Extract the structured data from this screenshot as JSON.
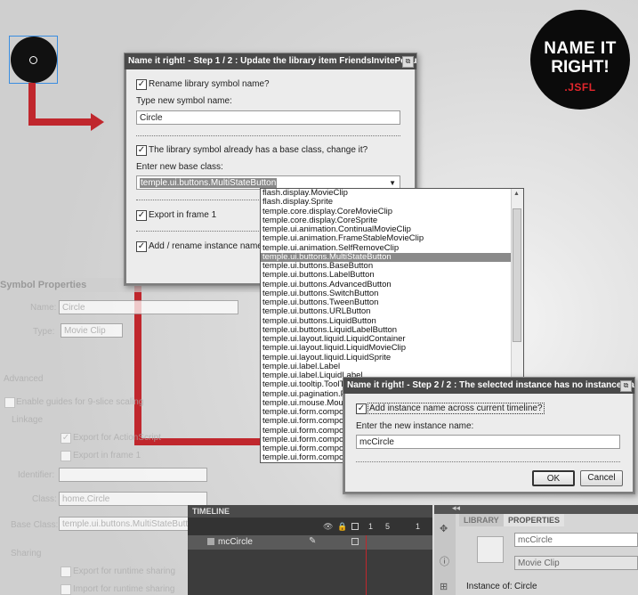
{
  "logo": {
    "line1": "NAME IT",
    "line2": "RIGHT!",
    "line3": ".JSFL"
  },
  "symbol_properties": {
    "title": "Symbol Properties",
    "name_label": "Name:",
    "name_value": "Circle",
    "type_label": "Type:",
    "type_value": "Movie Clip",
    "advanced_label": "Advanced",
    "guides_label": "Enable guides for 9-slice scaling",
    "linkage_label": "Linkage",
    "export_actionscript_label": "Export for ActionScript",
    "export_frame1_label": "Export in frame 1",
    "identifier_label": "Identifier:",
    "class_label": "Class:",
    "class_value": "home.Circle",
    "base_class_label": "Base Class:",
    "base_class_value": "temple.ui.buttons.MultiStateButton",
    "sharing_label": "Sharing",
    "export_runtime_label": "Export for runtime sharing",
    "import_runtime_label": "Import for runtime sharing"
  },
  "dialog1": {
    "title": "Name it right! - Step 1 / 2 : Update the library item FriendsInvitePopup",
    "rename_label": "Rename library symbol name?",
    "type_new_label": "Type new symbol name:",
    "symbol_name_value": "Circle",
    "base_class_question": "The library symbol already has a base class, change it?",
    "enter_base_label": "Enter new base class:",
    "base_class_value": "temple.ui.buttons.MultiStateButton",
    "export_frame_label": "Export in frame 1",
    "instance_label": "Add / rename instance name"
  },
  "base_class_options": [
    "flash.display.MovieClip",
    "flash.display.Sprite",
    "temple.core.display.CoreMovieClip",
    "temple.core.display.CoreSprite",
    "temple.ui.animation.ContinualMovieClip",
    "temple.ui.animation.FrameStableMovieClip",
    "temple.ui.animation.SelfRemoveClip",
    "temple.ui.buttons.MultiStateButton",
    "temple.ui.buttons.BaseButton",
    "temple.ui.buttons.LabelButton",
    "temple.ui.buttons.AdvancedButton",
    "temple.ui.buttons.SwitchButton",
    "temple.ui.buttons.TweenButton",
    "temple.ui.buttons.URLButton",
    "temple.ui.buttons.LiquidButton",
    "temple.ui.buttons.LiquidLabelButton",
    "temple.ui.layout.liquid.LiquidContainer",
    "temple.ui.layout.liquid.LiquidMovieClip",
    "temple.ui.layout.liquid.LiquidSprite",
    "temple.ui.label.Label",
    "temple.ui.label.LiquidLabel",
    "temple.ui.tooltip.ToolTip",
    "temple.ui.pagination.Pag",
    "temple.ui.mouse.MouseC",
    "temple.ui.form.componen",
    "temple.ui.form.componen",
    "temple.ui.form.componen",
    "temple.ui.form.componen",
    "temple.ui.form.componen",
    "temple.ui.form.componen"
  ],
  "selected_option": "temple.ui.buttons.MultiStateButton",
  "dialog2": {
    "title": "Name it right! - Step 2 / 2 : The selected instance has no instance name",
    "checkbox_label": "Add instance name across current timeline?",
    "enter_label": "Enter the new instance name:",
    "instance_value": "mcCircle",
    "ok_label": "OK",
    "cancel_label": "Cancel"
  },
  "timeline": {
    "title": "TIMELINE",
    "layer_name": "mcCircle",
    "frame1": "1",
    "frame5": "5"
  },
  "properties": {
    "tab_library": "LIBRARY",
    "tab_properties": "PROPERTIES",
    "instance_name": "mcCircle",
    "symbol_type": "Movie Clip",
    "instance_of_label": "Instance of:",
    "instance_of_value": "Circle"
  },
  "colors": {
    "accent_red": "#c0272d",
    "dialog_title": "#4a4a4a",
    "selected_item": "#8a8a8a"
  }
}
